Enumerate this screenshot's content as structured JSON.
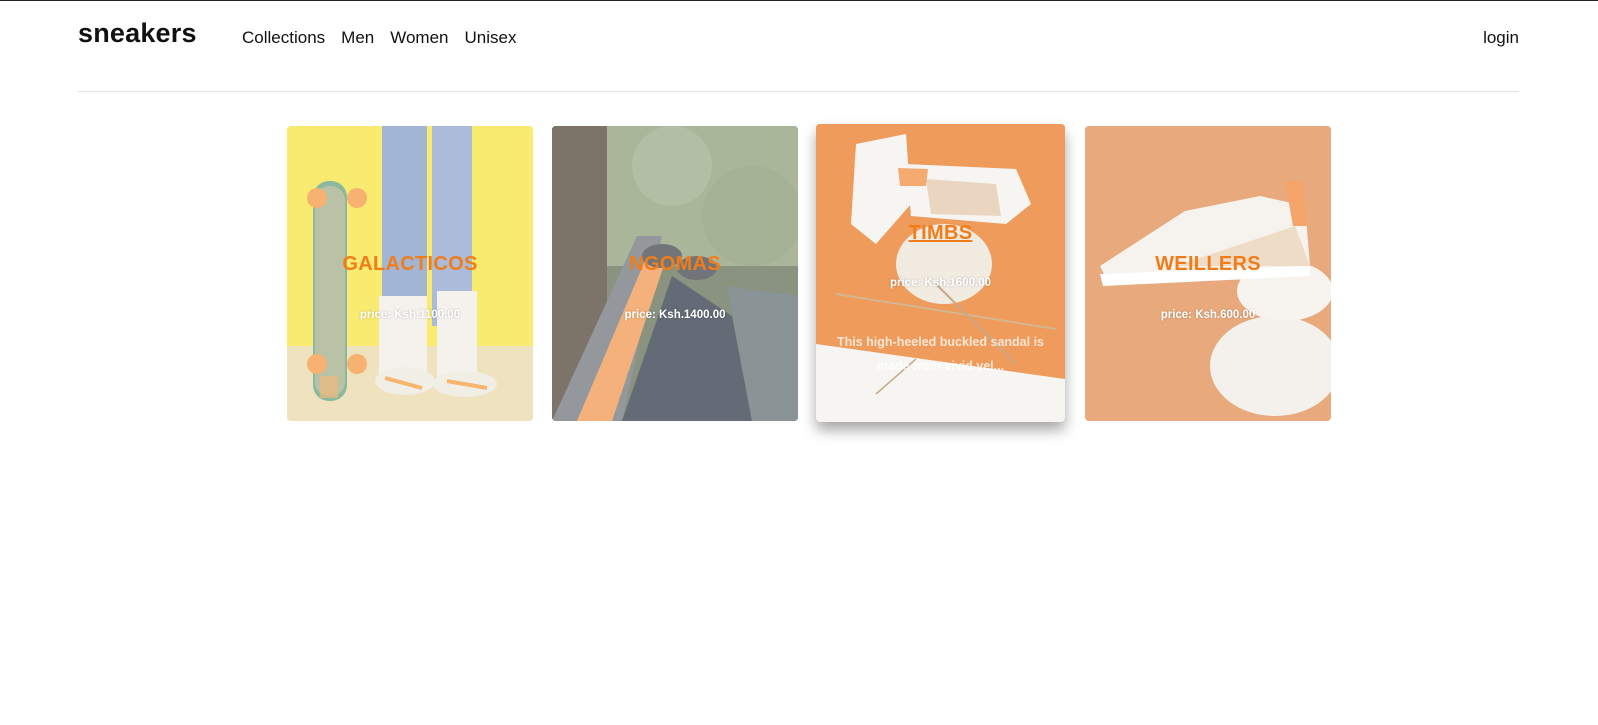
{
  "header": {
    "logo": "sneakers",
    "nav": [
      "Collections",
      "Men",
      "Women",
      "Unisex"
    ],
    "login": "login"
  },
  "products": [
    {
      "name": "GALACTICOS",
      "price": "price: Ksh.1100.00"
    },
    {
      "name": "NGOMAS",
      "price": "price: Ksh.1400.00"
    },
    {
      "name": "TIMBS",
      "price": "price: Ksh.1600.00",
      "description": "This high-heeled buckled sandal is made from vivid yel..."
    },
    {
      "name": "WEILLERS",
      "price": "price: Ksh.600.00"
    }
  ],
  "colors": {
    "accent": "#f07d1a",
    "price_text": "#ffffff",
    "divider": "#e2e2e2"
  }
}
